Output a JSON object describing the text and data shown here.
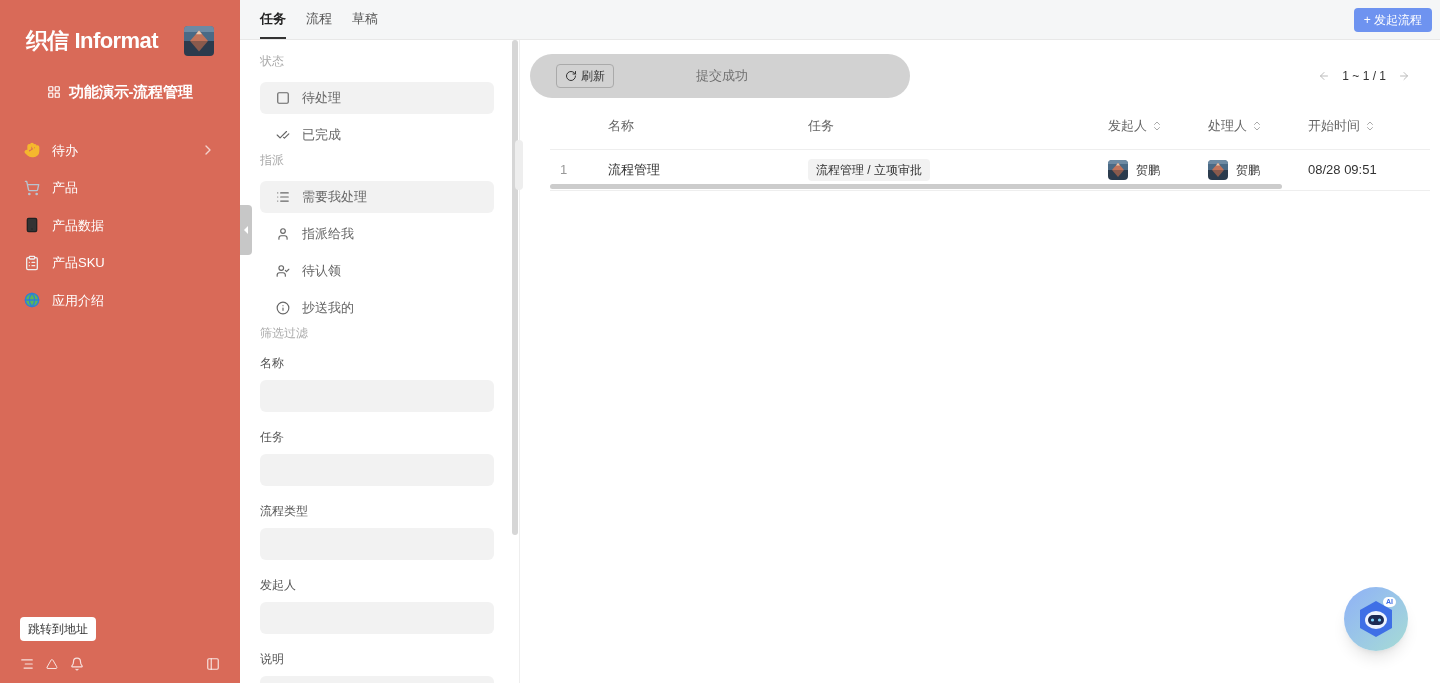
{
  "sidebar": {
    "logo": "织信 Informat",
    "app_title": "功能演示-流程管理",
    "items": [
      {
        "label": "待办",
        "expandable": true
      },
      {
        "label": "产品",
        "expandable": false
      },
      {
        "label": "产品数据",
        "expandable": false
      },
      {
        "label": "产品SKU",
        "expandable": false
      },
      {
        "label": "应用介绍",
        "expandable": false
      }
    ],
    "jump_button": "跳转到地址"
  },
  "tabs": [
    {
      "label": "任务",
      "selected": true
    },
    {
      "label": "流程",
      "selected": false
    },
    {
      "label": "草稿",
      "selected": false
    }
  ],
  "start_button": "+ 发起流程",
  "filters": {
    "status_heading": "状态",
    "status_items": [
      {
        "label": "待处理",
        "selected": true
      },
      {
        "label": "已完成",
        "selected": false
      }
    ],
    "assign_heading": "指派",
    "assign_items": [
      {
        "label": "需要我处理",
        "selected": true
      },
      {
        "label": "指派给我",
        "selected": false
      },
      {
        "label": "待认领",
        "selected": false
      },
      {
        "label": "抄送我的",
        "selected": false
      }
    ],
    "filter_heading": "筛选过滤",
    "fields": [
      {
        "label": "名称"
      },
      {
        "label": "任务"
      },
      {
        "label": "流程类型"
      },
      {
        "label": "发起人"
      },
      {
        "label": "说明"
      }
    ]
  },
  "toolbar": {
    "refresh_button": "刷新",
    "toast": "提交成功",
    "pagination": "1 ~ 1 / 1"
  },
  "table": {
    "columns": [
      {
        "label": "名称",
        "sortable": false
      },
      {
        "label": "任务",
        "sortable": false
      },
      {
        "label": "发起人",
        "sortable": true
      },
      {
        "label": "处理人",
        "sortable": true
      },
      {
        "label": "开始时间",
        "sortable": true
      }
    ],
    "rows": [
      {
        "index": "1",
        "name": "流程管理",
        "task": "流程管理 / 立项审批",
        "initiator": "贺鹏",
        "handler": "贺鹏",
        "start_time": "08/28 09:51"
      }
    ]
  },
  "ai_button": {
    "badge": "AI"
  }
}
